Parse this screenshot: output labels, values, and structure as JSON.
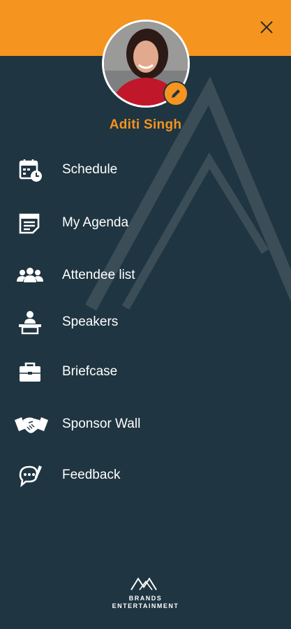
{
  "user": {
    "name": "Aditi Singh"
  },
  "menu": {
    "items": [
      {
        "label": "Schedule",
        "icon": "calendar-clock-icon"
      },
      {
        "label": "My Agenda",
        "icon": "notepad-icon"
      },
      {
        "label": "Attendee list",
        "icon": "people-group-icon"
      },
      {
        "label": "Speakers",
        "icon": "speaker-podium-icon"
      },
      {
        "label": "Briefcase",
        "icon": "briefcase-icon"
      },
      {
        "label": "Sponsor Wall",
        "icon": "handshake-icon"
      },
      {
        "label": "Feedback",
        "icon": "feedback-bubble-icon"
      }
    ]
  },
  "brand": {
    "line1": "BRANDS",
    "line2": "ENTERTAINMENT"
  },
  "colors": {
    "accent": "#f5941f",
    "background": "#1f3541",
    "text": "#ffffff"
  }
}
